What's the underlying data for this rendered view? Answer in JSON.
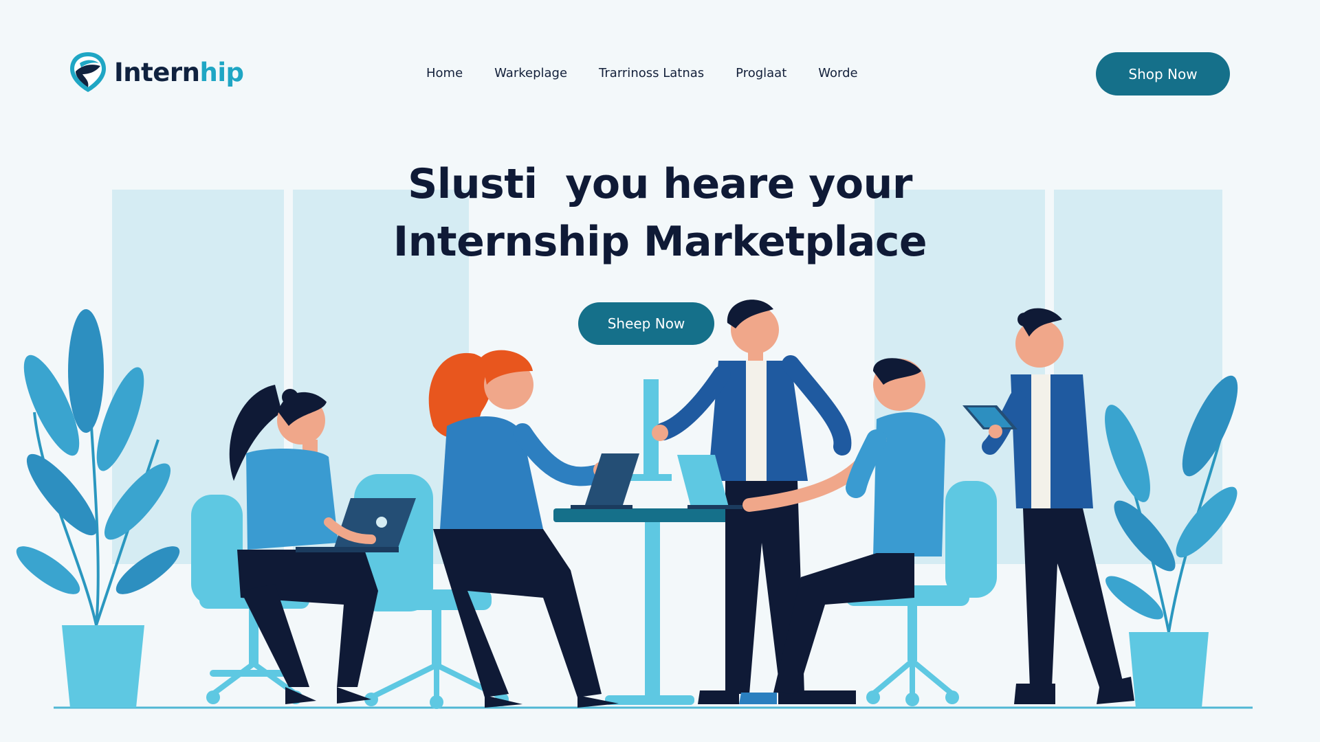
{
  "brand": {
    "name_part1": "Intern",
    "name_part2": "hip",
    "colors": {
      "dark": "#10223f",
      "accent": "#1fa6c4",
      "button": "#15708a"
    }
  },
  "nav": {
    "items": [
      {
        "label": "Home"
      },
      {
        "label": "Warkeplage"
      },
      {
        "label": "Trarrinoss Latnas"
      },
      {
        "label": "Proglaat"
      },
      {
        "label": "Worde"
      }
    ],
    "cta_label": "Shop Now"
  },
  "hero": {
    "title_line1": "Slusti  you heare your",
    "title_line2": "Internship Marketplace",
    "cta_label": "Sheep Now"
  },
  "illustration": {
    "icons": [
      "plant-icon",
      "laptop-icon",
      "tablet-icon",
      "desk-icon",
      "office-chair-icon"
    ]
  }
}
